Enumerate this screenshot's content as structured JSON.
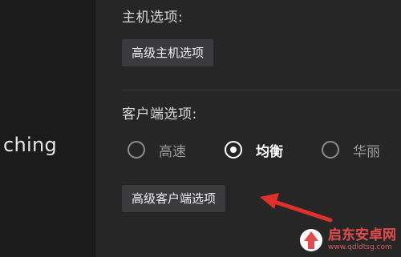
{
  "nav": {
    "partial_label": "ching"
  },
  "host_section": {
    "title": "主机选项:",
    "advanced_button": "高级主机选项"
  },
  "client_section": {
    "title": "客户端选项:",
    "options": [
      {
        "label": "高速",
        "checked": false
      },
      {
        "label": "均衡",
        "checked": true
      },
      {
        "label": "华丽",
        "checked": false
      }
    ],
    "advanced_button": "高级客户端选项"
  },
  "annotation": {
    "arrow_color": "#e0302a"
  },
  "watermark": {
    "name": "启东安卓网",
    "url": "www.qdldtsg.com"
  },
  "colors": {
    "panel_bg": "#262627",
    "button_bg": "#3b3b3d",
    "nav_bg": "#1b1b1c"
  }
}
